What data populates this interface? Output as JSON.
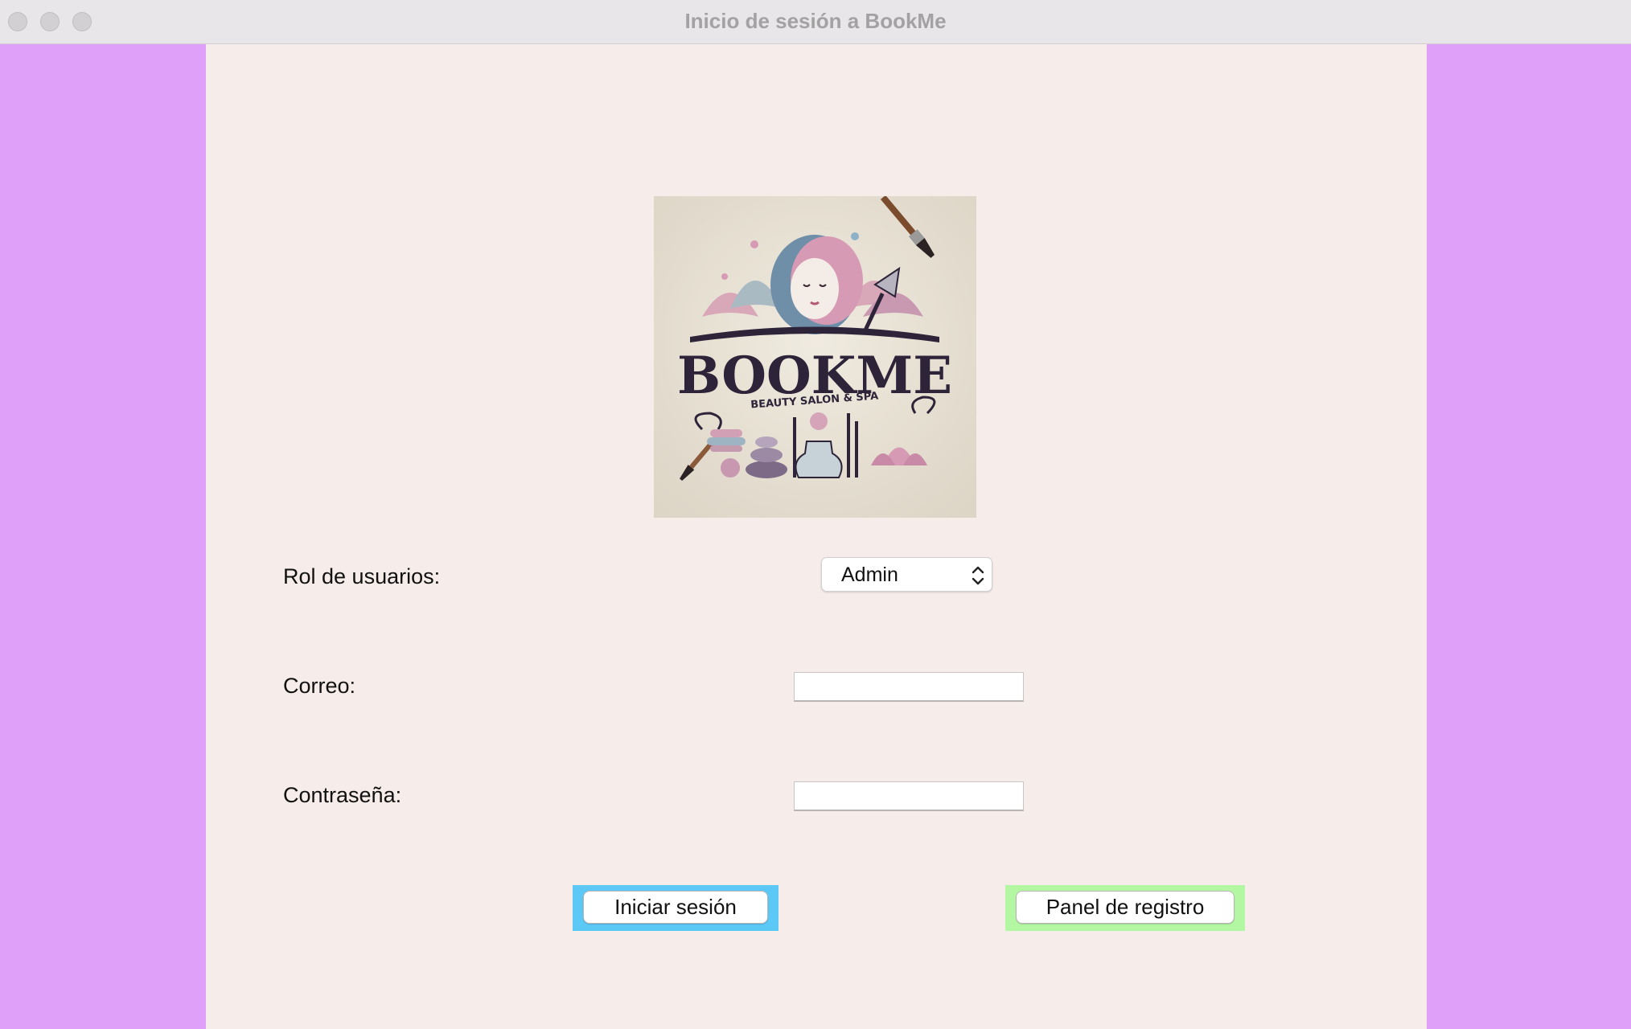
{
  "window": {
    "title": "Inicio de sesión a BookMe"
  },
  "logo": {
    "brand": "BOOKME",
    "tagline": "BEAUTY SALON & SPA"
  },
  "form": {
    "role_label": "Rol de usuarios:",
    "role_selected": "Admin",
    "email_label": "Correo:",
    "email_value": "",
    "password_label": "Contraseña:",
    "password_value": ""
  },
  "buttons": {
    "login_label": "Iniciar sesión",
    "register_label": "Panel de registro"
  },
  "colors": {
    "side_background": "#dea0f8",
    "panel_background": "#f6ece9",
    "login_button_frame": "#5bc8f5",
    "register_button_frame": "#b4f7a2"
  }
}
